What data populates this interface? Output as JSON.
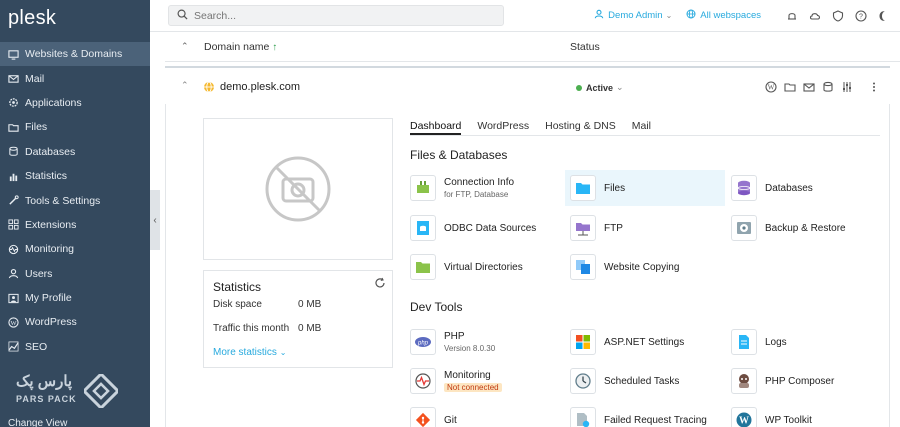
{
  "app": {
    "logo": "plesk"
  },
  "sidebar": {
    "items": [
      {
        "label": "Websites & Domains",
        "icon": "monitor-icon",
        "active": true
      },
      {
        "label": "Mail",
        "icon": "mail-icon"
      },
      {
        "label": "Applications",
        "icon": "gear-icon"
      },
      {
        "label": "Files",
        "icon": "folder-icon"
      },
      {
        "label": "Databases",
        "icon": "database-icon"
      },
      {
        "label": "Statistics",
        "icon": "chart-icon"
      },
      {
        "label": "Tools & Settings",
        "icon": "tools-icon"
      },
      {
        "label": "Extensions",
        "icon": "extensions-icon"
      },
      {
        "label": "Monitoring",
        "icon": "monitoring-icon"
      },
      {
        "label": "Users",
        "icon": "user-icon"
      },
      {
        "label": "My Profile",
        "icon": "profile-icon"
      },
      {
        "label": "WordPress",
        "icon": "wordpress-icon"
      },
      {
        "label": "SEO",
        "icon": "seo-icon"
      }
    ],
    "cut_item": "Change View",
    "watermark": {
      "fa": "پارس پک",
      "en": "PARS PACK"
    }
  },
  "topbar": {
    "search_placeholder": "Search...",
    "user": "Demo Admin",
    "webspaces": "All webspaces"
  },
  "table": {
    "col_domain": "Domain name",
    "col_status": "Status",
    "sort_arrow": "↑"
  },
  "domain": {
    "name": "demo.plesk.com",
    "status": "Active"
  },
  "stats": {
    "title": "Statistics",
    "disk_label": "Disk space",
    "disk_value": "0 MB",
    "traffic_label": "Traffic this month",
    "traffic_value": "0 MB",
    "more": "More statistics"
  },
  "tabs": [
    "Dashboard",
    "WordPress",
    "Hosting & DNS",
    "Mail"
  ],
  "sections": {
    "files_db": "Files & Databases",
    "dev_tools": "Dev Tools"
  },
  "files_db_tools": [
    {
      "label": "Connection Info",
      "sub": "for FTP, Database",
      "icon": "plug-icon"
    },
    {
      "label": "Files",
      "icon": "folder-icon"
    },
    {
      "label": "Databases",
      "icon": "database-icon"
    },
    {
      "label": "ODBC Data Sources",
      "icon": "odbc-icon"
    },
    {
      "label": "FTP",
      "icon": "ftp-icon"
    },
    {
      "label": "Backup & Restore",
      "icon": "backup-icon"
    },
    {
      "label": "Virtual Directories",
      "icon": "folder-icon"
    },
    {
      "label": "Website Copying",
      "icon": "copy-icon"
    }
  ],
  "dev_tools": [
    {
      "label": "PHP",
      "sub": "Version 8.0.30",
      "icon": "php-icon"
    },
    {
      "label": "ASP.NET Settings",
      "icon": "aspnet-icon"
    },
    {
      "label": "Logs",
      "icon": "logs-icon"
    },
    {
      "label": "Monitoring",
      "sub": "Not connected",
      "icon": "monitoring-icon"
    },
    {
      "label": "Scheduled Tasks",
      "icon": "clock-icon"
    },
    {
      "label": "PHP Composer",
      "icon": "composer-icon"
    },
    {
      "label": "Git",
      "icon": "git-icon"
    },
    {
      "label": "Failed Request Tracing",
      "icon": "tracing-icon"
    },
    {
      "label": "WP Toolkit",
      "icon": "wordpress-icon"
    }
  ]
}
